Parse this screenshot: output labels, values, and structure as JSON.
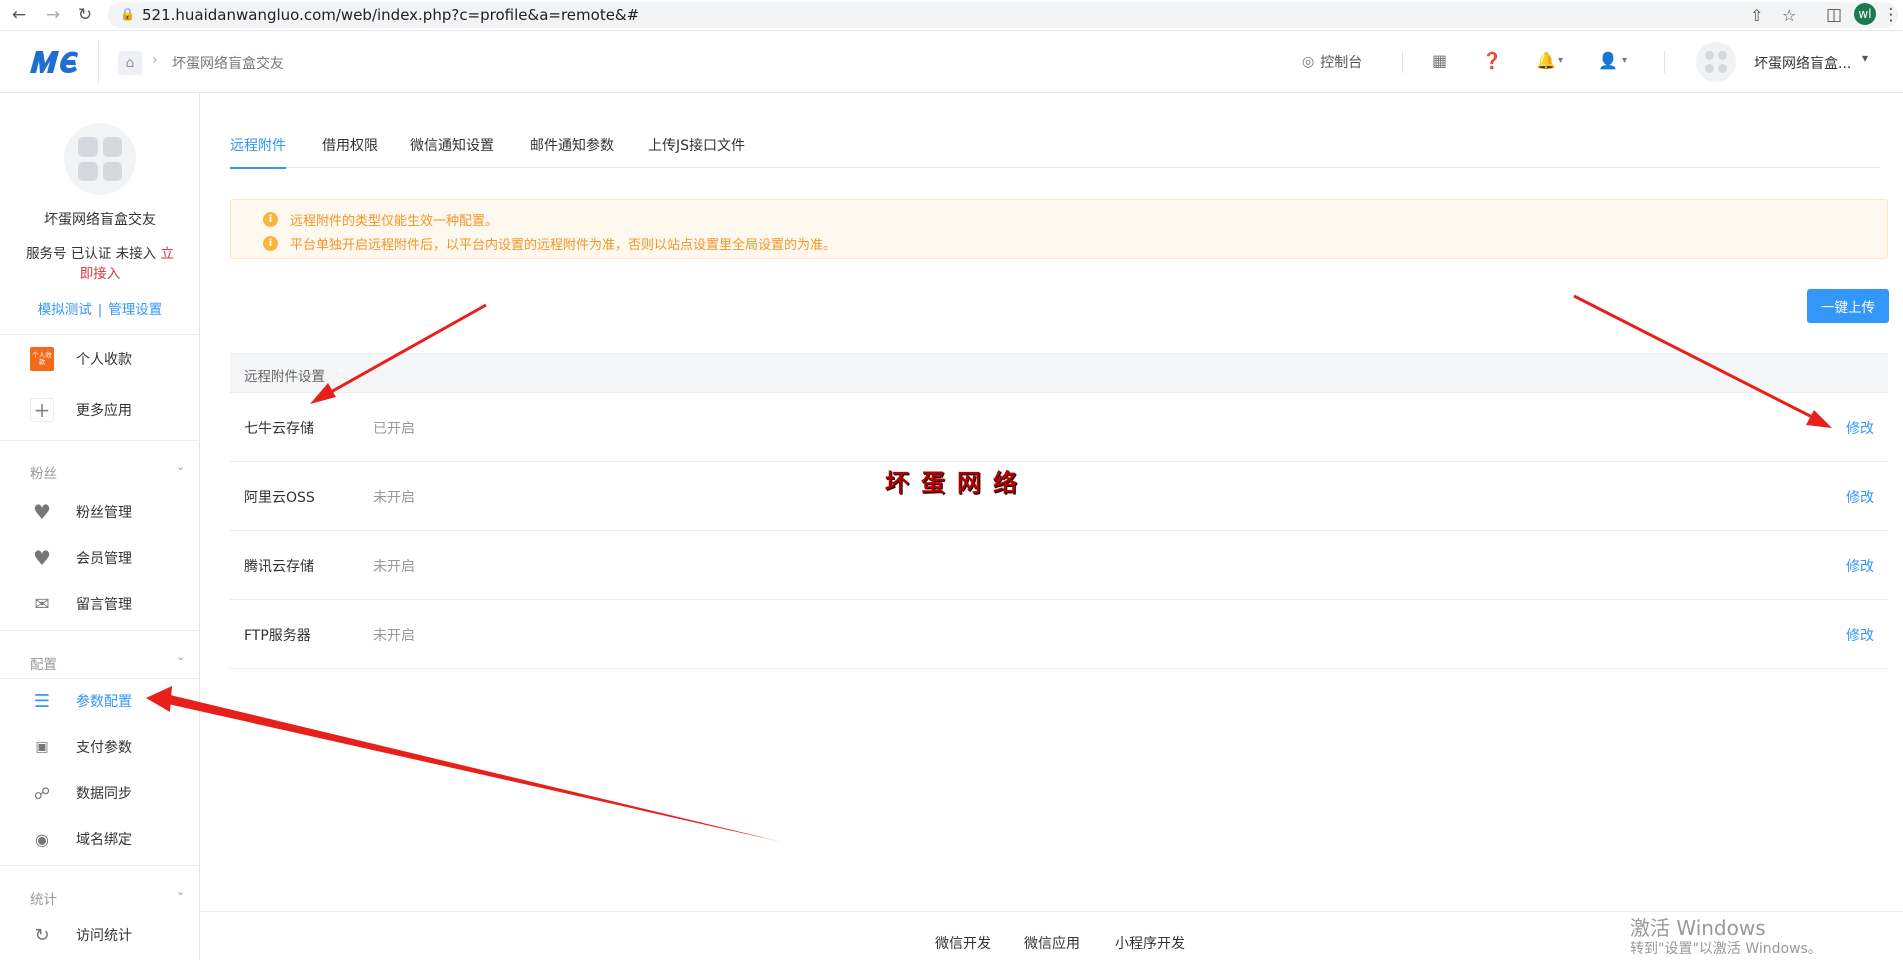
{
  "browser": {
    "url": "521.huaidanwangluo.com/web/index.php?c=profile&a=remote&#",
    "profile_initials": "wl"
  },
  "header": {
    "breadcrumb": "坏蛋网络盲盒交友",
    "console": "控制台",
    "account_name": "坏蛋网络盲盒..."
  },
  "sidebar": {
    "name": "坏蛋网络盲盒交友",
    "status_prefix": "服务号 已认证 未接入 ",
    "status_action": "立即接入",
    "link_test": "模拟测试",
    "link_sep": "|",
    "link_manage": "管理设置",
    "apps": [
      {
        "label": "个人收款",
        "badge": "个人收款"
      },
      {
        "label": "更多应用"
      }
    ],
    "groups": {
      "fans": {
        "title": "粉丝",
        "items": [
          "粉丝管理",
          "会员管理",
          "留言管理"
        ]
      },
      "config": {
        "title": "配置",
        "items": [
          "参数配置",
          "支付参数",
          "数据同步",
          "域名绑定"
        ]
      },
      "stats": {
        "title": "统计",
        "items": [
          "访问统计"
        ]
      }
    }
  },
  "tabs": [
    "远程附件",
    "借用权限",
    "微信通知设置",
    "邮件通知参数",
    "上传JS接口文件"
  ],
  "alert": [
    "远程附件的类型仅能生效一种配置。",
    "平台单独开启远程附件后，以平台内设置的远程附件为准，否则以站点设置里全局设置的为准。"
  ],
  "upload_button": "一键上传",
  "panel_title": "远程附件设置",
  "rows": [
    {
      "name": "七牛云存储",
      "state": "已开启",
      "action": "修改"
    },
    {
      "name": "阿里云OSS",
      "state": "未开启",
      "action": "修改"
    },
    {
      "name": "腾讯云存储",
      "state": "未开启",
      "action": "修改"
    },
    {
      "name": "FTP服务器",
      "state": "未开启",
      "action": "修改"
    }
  ],
  "watermark": "坏蛋网络",
  "footer": [
    "微信开发",
    "微信应用",
    "小程序开发"
  ],
  "windows_activation": [
    "激活 Windows",
    "转到\"设置\"以激活 Windows。"
  ],
  "colors": {
    "accent": "#3296fa",
    "warning": "#f0962a",
    "annotation": "#e8201a"
  }
}
